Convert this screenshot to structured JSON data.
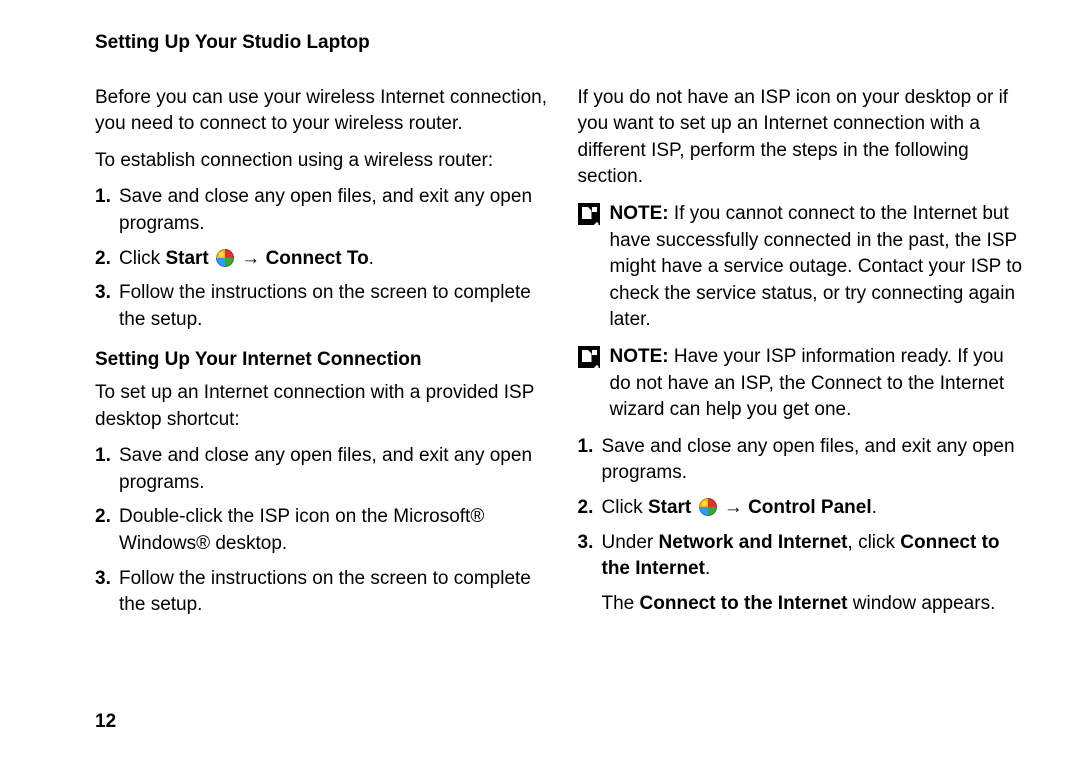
{
  "header": "Setting Up Your Studio Laptop",
  "pageNumber": "12",
  "left": {
    "intro": "Before you can use your wireless Internet connection, you need to connect to your wireless router.",
    "establish": "To establish connection using a wireless router:",
    "steps1": {
      "n1": "1.",
      "t1": "Save and close any open files, and exit any open programs.",
      "n2": "2.",
      "t2a": "Click ",
      "t2b": "Start",
      "t2c": " ",
      "t2d": " → Connect To",
      "t2e": ".",
      "n3": "3.",
      "t3": "Follow the instructions on the screen to complete the setup."
    },
    "subhead": "Setting Up Your Internet Connection",
    "setup": "To set up an Internet connection with a provided ISP desktop shortcut:",
    "steps2": {
      "n1": "1.",
      "t1": "Save and close any open files, and exit any open programs.",
      "n2": "2.",
      "t2": "Double-click the ISP icon on the Microsoft® Windows® desktop.",
      "n3": "3.",
      "t3": "Follow the instructions on the screen to complete the setup."
    }
  },
  "right": {
    "intro": "If you do not have an ISP icon on your desktop or if you want to set up an Internet connection with a different ISP, perform the steps in the following section.",
    "note1_label": "NOTE:",
    "note1": " If you cannot connect to the Internet but have successfully connected in the past, the ISP might have a service outage. Contact your ISP to check the service status, or try connecting again later.",
    "note2_label": "NOTE:",
    "note2": " Have your ISP information ready. If you do not have an ISP, the Connect to the Internet wizard can help you get one.",
    "steps": {
      "n1": "1.",
      "t1": "Save and close any open files, and exit any open programs.",
      "n2": "2.",
      "t2a": "Click ",
      "t2b": "Start",
      "t2c": " ",
      "t2d": " → Control Panel",
      "t2e": ".",
      "n3": "3.",
      "t3a": "Under ",
      "t3b": "Network and Internet",
      "t3c": ", click ",
      "t3d": "Connect to the Internet",
      "t3e": "."
    },
    "result_a": "The ",
    "result_b": "Connect to the Internet",
    "result_c": " window appears."
  }
}
